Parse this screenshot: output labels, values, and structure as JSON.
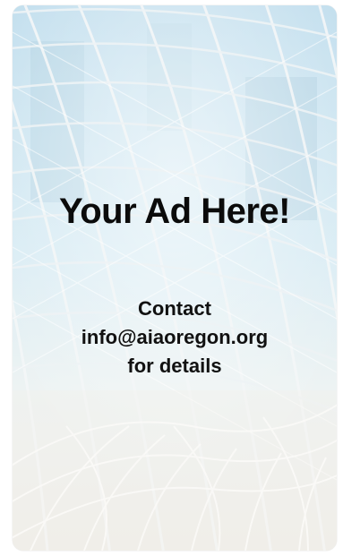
{
  "ad": {
    "headline": "Your Ad Here!",
    "contact_line": "Contact",
    "email": "info@aiaoregon.org",
    "details_line": "for details"
  },
  "colors": {
    "text": "#0b0b0b",
    "sky_top": "#c9e2ef",
    "sky_bottom": "#ecebe6",
    "frame": "#ffffff"
  }
}
